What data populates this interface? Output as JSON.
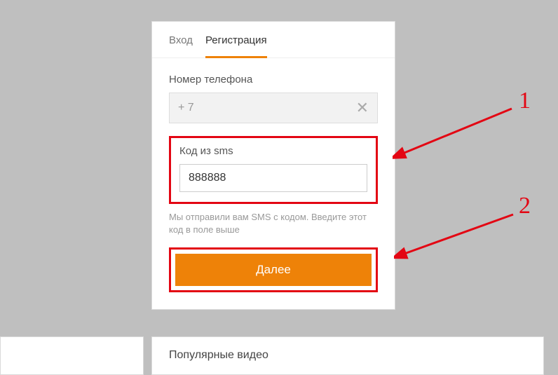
{
  "tabs": {
    "login": "Вход",
    "register": "Регистрация"
  },
  "form": {
    "phone_label": "Номер телефона",
    "phone_prefix": "+ 7",
    "sms_label": "Код из sms",
    "sms_value": "888888",
    "hint": "Мы отправили вам SMS с кодом. Введите этот код в поле выше",
    "next_button": "Далее"
  },
  "footer": {
    "title": "Популярные видео"
  },
  "annotations": {
    "one": "1",
    "two": "2"
  }
}
